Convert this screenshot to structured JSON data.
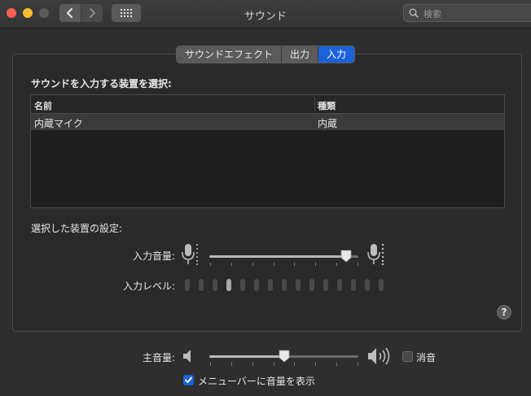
{
  "window": {
    "title": "サウンド",
    "search_placeholder": "検索"
  },
  "toolbar": {
    "back_icon": "chevron-left-icon",
    "forward_icon": "chevron-right-icon",
    "grid_icon": "grid-icon"
  },
  "tabs": [
    {
      "label": "サウンドエフェクト",
      "active": false
    },
    {
      "label": "出力",
      "active": false
    },
    {
      "label": "入力",
      "active": true
    }
  ],
  "input": {
    "select_title": "サウンドを入力する装置を選択:",
    "columns": [
      "名前",
      "種類"
    ],
    "devices": [
      {
        "name": "内蔵マイク",
        "type": "内蔵",
        "selected": true
      }
    ],
    "settings_title": "選択した装置の設定:",
    "volume_label": "入力音量:",
    "volume_value": 0.92,
    "level_label": "入力レベル:",
    "level_bars_total": 15,
    "level_bars_lit": 4
  },
  "help_label": "?",
  "output": {
    "volume_label": "主音量:",
    "volume_value": 0.5,
    "mute_label": "消音",
    "mute_checked": false,
    "menubar_label": "メニューバーに音量を表示",
    "menubar_checked": true
  },
  "colors": {
    "accent": "#1b62d8",
    "close": "#fe5f57",
    "minimize": "#febc2e"
  }
}
